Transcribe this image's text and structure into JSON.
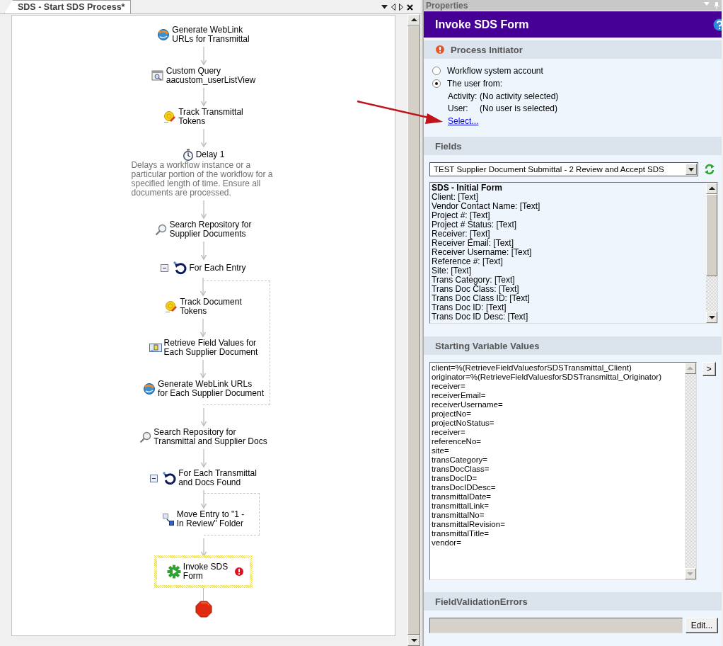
{
  "document_tab": {
    "title": "SDS - Start SDS Process*",
    "selected": true
  },
  "workflow": {
    "steps": [
      {
        "kind": "weblink",
        "label": "Generate WebLink\nURLs for Transmittal"
      },
      {
        "kind": "query",
        "label": "Custom Query\naacustom_userListView"
      },
      {
        "kind": "token",
        "label": "Track Transmittal\nTokens"
      },
      {
        "kind": "delay",
        "label": "Delay 1",
        "description": "Delays a workflow instance or a\nparticular portion of the workflow for a\nspecified length of time. Ensure all\ndocuments are processed."
      },
      {
        "kind": "search",
        "label": "Search Repository for\nSupplier Documents"
      },
      {
        "kind": "loop",
        "label": "For Each Entry",
        "expanded": true,
        "children": [
          {
            "kind": "token",
            "label": "Track Document\nTokens"
          },
          {
            "kind": "retrieve",
            "label": "Retrieve Field Values for\nEach Supplier Document"
          },
          {
            "kind": "weblink",
            "label": "Generate WebLink URLs\nfor Each Supplier Document"
          }
        ]
      },
      {
        "kind": "search",
        "label": "Search Repository for\nTransmittal and Supplier Docs"
      },
      {
        "kind": "loop",
        "label": "For Each Transmittal\nand Docs Found",
        "expanded": true,
        "children": [
          {
            "kind": "move",
            "label": "Move Entry to \"1 -\nIn Review\" Folder"
          }
        ]
      },
      {
        "kind": "invoke",
        "label": "Invoke SDS\nForm",
        "selected": true,
        "error": true
      }
    ]
  },
  "properties": {
    "pane_title": "Properties",
    "title": "Invoke SDS Form",
    "process_initiator": {
      "heading": "Process Initiator",
      "error": true,
      "options": [
        {
          "label": "Workflow system account",
          "selected": false
        },
        {
          "label": "The user from:",
          "selected": true
        }
      ],
      "details": [
        {
          "label": "Activity:",
          "value": "(No activity selected)"
        },
        {
          "label": "User:",
          "value": "(No user is selected)"
        }
      ],
      "link": "Select..."
    },
    "fields": {
      "heading": "Fields",
      "form_dropdown": "TEST Supplier Document Submittal - 2 Review and Accept SDS",
      "list_heading": "SDS - Initial Form",
      "items": [
        "Client: [Text]",
        "Vendor Contact Name: [Text]",
        "Project #: [Text]",
        "Project # Status: [Text]",
        "Receiver: [Text]",
        "Receiver Email: [Text]",
        "Receiver Username: [Text]",
        "Reference #: [Text]",
        "Site: [Text]",
        "Trans Category: [Text]",
        "Trans Doc Class: [Text]",
        "Trans Doc Class ID: [Text]",
        "Trans Doc ID: [Text]",
        "Trans Doc ID Desc: [Text]"
      ]
    },
    "starting_variable_values": {
      "heading": "Starting Variable Values",
      "insert_button": ">",
      "lines": [
        "client=%(RetrieveFieldValuesforSDSTransmittal_Client)",
        "originator=%(RetrieveFieldValuesforSDSTransmittal_Originator)",
        "receiver=",
        "receiverEmail=",
        "receiverUsername=",
        "projectNo=",
        "projectNoStatus=",
        "receiver=",
        "referenceNo=",
        "site=",
        "transCategory=",
        "transDocClass=",
        "transDocID=",
        "transDocIDDesc=",
        "transmittalDate=",
        "transmittalLink=",
        "transmittalNo=",
        "transmittalRevision=",
        "transmittalTitle=",
        "vendor="
      ]
    },
    "field_validation_errors": {
      "heading": "FieldValidationErrors",
      "edit_button": "Edit..."
    }
  }
}
